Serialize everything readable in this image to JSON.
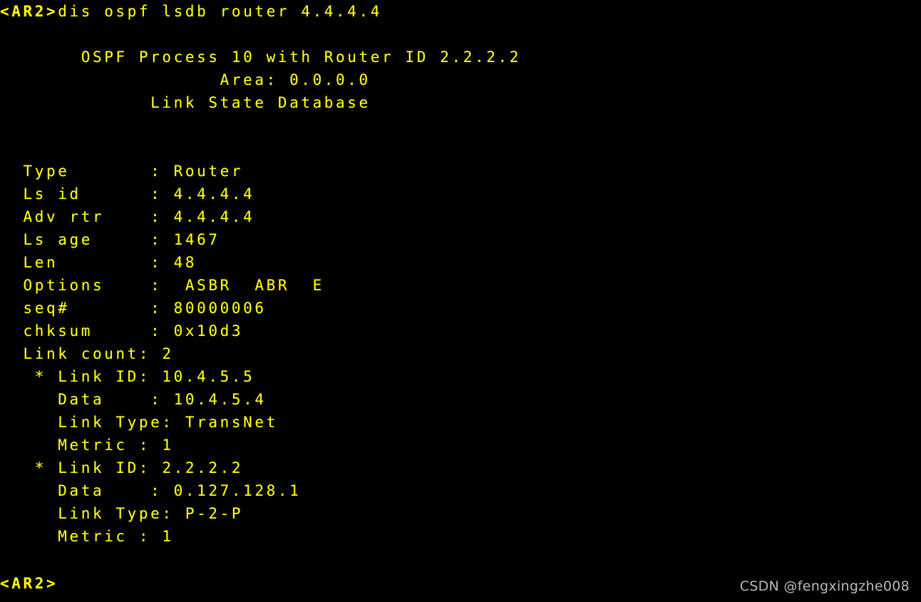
{
  "terminal": {
    "device_prompt": "<AR2>",
    "background_color": "#000000",
    "text_color": "#ffff00",
    "watermark_color": "#c9c9c9",
    "command_line": {
      "prompt": "<AR2>",
      "command": "dis ospf lsdb router 4.4.4.4"
    },
    "header": {
      "process_line": "OSPF Process 10 with Router ID 2.2.2.2",
      "area_line": "Area: 0.0.0.0",
      "database_line": "Link State Database"
    },
    "lsa": {
      "rows": [
        {
          "label": "Type",
          "separator": ":",
          "value": "Router"
        },
        {
          "label": "Ls id",
          "separator": ":",
          "value": "4.4.4.4"
        },
        {
          "label": "Adv rtr",
          "separator": ":",
          "value": "4.4.4.4"
        },
        {
          "label": "Ls age",
          "separator": ":",
          "value": "1467"
        },
        {
          "label": "Len",
          "separator": ":",
          "value": "48"
        },
        {
          "label": "Options",
          "separator": ":",
          "value": " ASBR  ABR  E"
        },
        {
          "label": "seq#",
          "separator": ":",
          "value": "80000006"
        },
        {
          "label": "chksum",
          "separator": ":",
          "value": "0x10d3"
        },
        {
          "label": "Link count",
          "separator": ":",
          "value": "2"
        }
      ],
      "links": [
        {
          "marker": "*",
          "link_id_label": "Link ID:",
          "link_id": "10.4.5.5",
          "data_label": "Data    :",
          "data": "10.4.5.4",
          "link_type_label": "Link Type:",
          "link_type": "TransNet",
          "metric_label": "Metric :",
          "metric": "1"
        },
        {
          "marker": "*",
          "link_id_label": "Link ID:",
          "link_id": "2.2.2.2",
          "data_label": "Data    :",
          "data": "0.127.128.1",
          "link_type_label": "Link Type:",
          "link_type": "P-2-P",
          "metric_label": "Metric :",
          "metric": "1"
        }
      ]
    },
    "trailing_prompt": "<AR2>",
    "watermark": "CSDN @fengxingzhe008"
  },
  "lines": {
    "l01_prompt": "<AR2>",
    "l01_command": "dis ospf lsdb router 4.4.4.4",
    "l02": "",
    "l03": "       OSPF Process 10 with Router ID 2.2.2.2",
    "l04": "                   Area: 0.0.0.0",
    "l05": "             Link State Database",
    "l06": "",
    "l07": "",
    "l08": "  Type       : Router",
    "l09": "  Ls id      : 4.4.4.4",
    "l10": "  Adv rtr    : 4.4.4.4",
    "l11": "  Ls age     : 1467",
    "l12": "  Len        : 48",
    "l13": "  Options    :  ASBR  ABR  E",
    "l14": "  seq#       : 80000006",
    "l15": "  chksum     : 0x10d3",
    "l16": "  Link count: 2",
    "l17": "   * Link ID: 10.4.5.5",
    "l18": "     Data    : 10.4.5.4",
    "l19": "     Link Type: TransNet",
    "l20": "     Metric : 1",
    "l21": "   * Link ID: 2.2.2.2",
    "l22": "     Data    : 0.127.128.1",
    "l23": "     Link Type: P-2-P",
    "l24": "     Metric : 1",
    "l25": "",
    "l26_prompt": "<AR2>"
  }
}
